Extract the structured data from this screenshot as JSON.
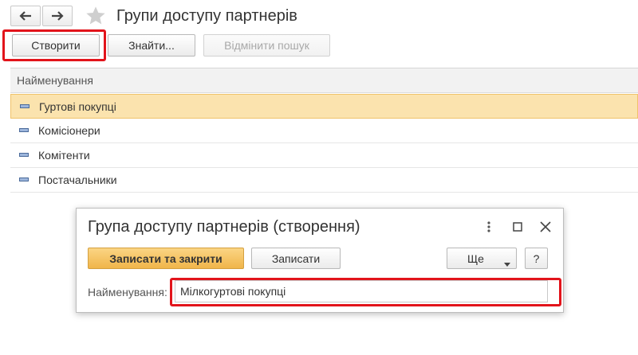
{
  "nav": {
    "back_icon": "arrow-left-icon",
    "forward_icon": "arrow-right-icon",
    "favorite_icon": "star-icon"
  },
  "page": {
    "title": "Групи доступу партнерів"
  },
  "toolbar": {
    "create_label": "Створити",
    "find_label": "Знайти...",
    "cancel_search_label": "Відмінити пошук"
  },
  "list": {
    "header": "Найменування",
    "items": [
      {
        "label": "Гуртові покупці",
        "selected": true
      },
      {
        "label": "Комісіонери",
        "selected": false
      },
      {
        "label": "Комітенти",
        "selected": false
      },
      {
        "label": "Постачальники",
        "selected": false
      }
    ]
  },
  "dialog": {
    "title": "Група доступу партнерів (створення)",
    "save_close_label": "Записати та закрити",
    "save_label": "Записати",
    "more_label": "Ще",
    "help_label": "?",
    "field_label": "Найменування:",
    "field_value": "Мілкогуртові покупці",
    "icons": [
      "more-vert-icon",
      "maximize-icon",
      "close-icon"
    ]
  },
  "colors": {
    "highlight_red": "#e2141b",
    "selected_row": "#fbe3ae",
    "primary_button": "#f0b54a"
  }
}
